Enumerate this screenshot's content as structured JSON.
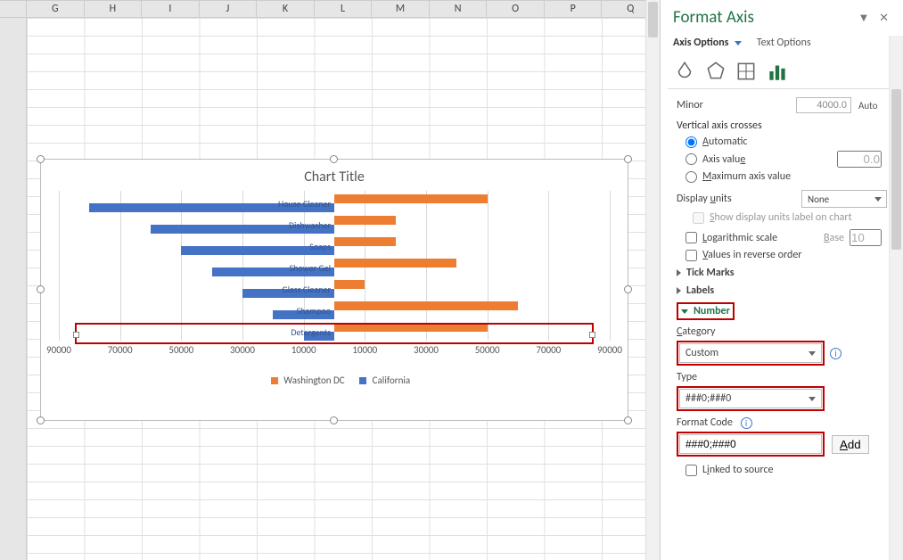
{
  "columns": [
    "G",
    "H",
    "I",
    "J",
    "K",
    "L",
    "M",
    "N",
    "O",
    "P",
    "Q"
  ],
  "chart": {
    "title": "Chart Title",
    "legend": {
      "series1": "Washington DC",
      "series2": "California"
    },
    "axis_ticks": [
      "90000",
      "70000",
      "50000",
      "30000",
      "10000",
      "10000",
      "30000",
      "50000",
      "70000",
      "90000"
    ]
  },
  "chart_data": {
    "type": "bar",
    "orientation": "horizontal",
    "diverging": true,
    "categories": [
      "House Cleaner",
      "Dishwasher",
      "Soaps",
      "Shower Gel",
      "Glass Cleaner",
      "Shampoo",
      "Detergents"
    ],
    "series": [
      {
        "name": "Washington DC",
        "color": "#ED7D31",
        "values": [
          50000,
          20000,
          20000,
          40000,
          10000,
          60000,
          50000
        ]
      },
      {
        "name": "California",
        "color": "#4472C4",
        "values": [
          -80000,
          -60000,
          -50000,
          -40000,
          -30000,
          -20000,
          -10000
        ]
      }
    ],
    "xlabel": "",
    "ylabel": "",
    "xlim": [
      -90000,
      90000
    ],
    "grid": true,
    "legend_position": "bottom",
    "title": "Chart Title",
    "number_format": "###0;###0"
  },
  "panel": {
    "title": "Format Axis",
    "tabs": {
      "axis_options": "Axis Options",
      "text_options": "Text Options"
    },
    "minor_label": "Minor",
    "minor_value": "4000.0",
    "auto_label": "Auto",
    "crosses_head": "Vertical axis crosses",
    "radios": {
      "automatic": "Automatic",
      "axis_value": "Axis value",
      "axis_value_num": "0.0",
      "max_value": "Maximum axis value"
    },
    "display_units_label": "Display units",
    "display_units_value": "None",
    "show_units_label": "Show display units label on chart",
    "log_scale_label": "Logarithmic scale",
    "log_base_label": "Base",
    "log_base_value": "10",
    "reverse_label": "Values in reverse order",
    "acc_tick": "Tick Marks",
    "acc_labels": "Labels",
    "acc_number": "Number",
    "category_label": "Category",
    "category_value": "Custom",
    "type_label": "Type",
    "type_value": "###0;###0",
    "format_code_label": "Format Code",
    "format_code_value": "###0;###0",
    "add_button": "Add",
    "linked_label": "Linked to source"
  }
}
